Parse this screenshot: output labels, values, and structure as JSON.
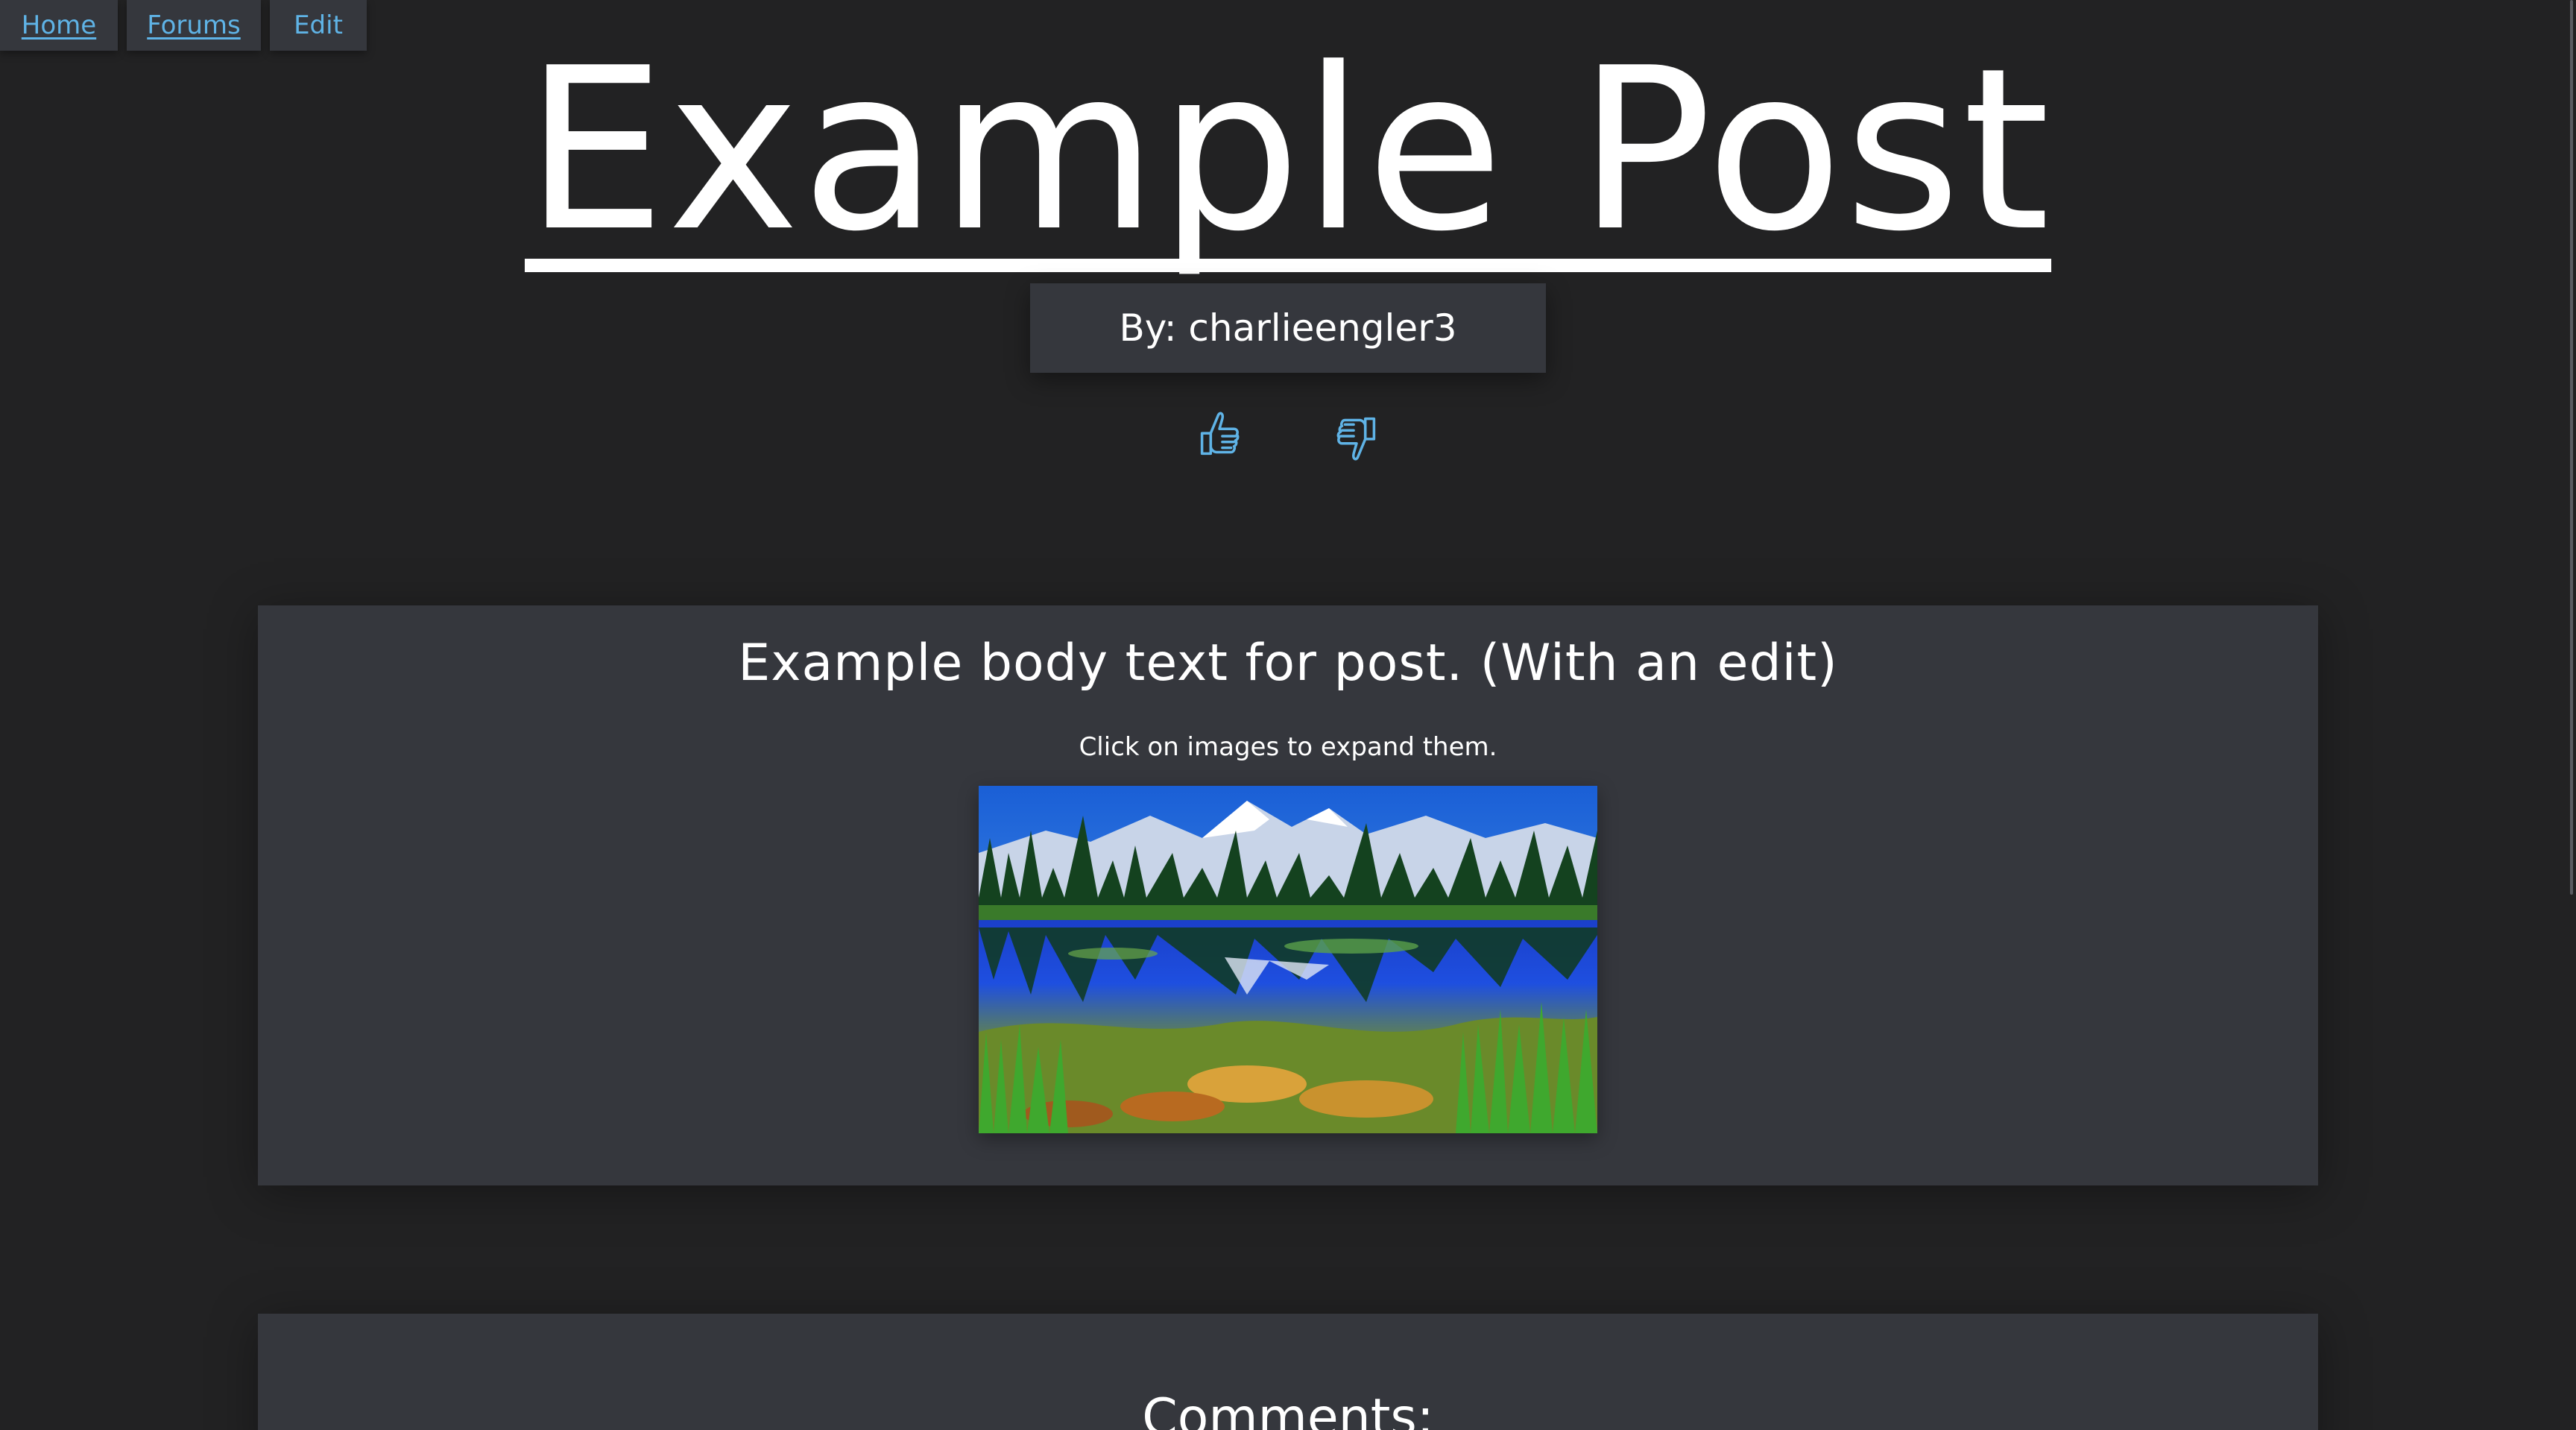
{
  "nav": {
    "items": [
      {
        "label": "Home"
      },
      {
        "label": "Forums"
      },
      {
        "label": "Edit"
      }
    ]
  },
  "post": {
    "title": "Example Post",
    "author_label": "By: charlieengler3",
    "body": "Example body text for post. (With an edit)",
    "image_hint": "Click on images to expand them."
  },
  "votes": {
    "like_icon": "thumbs-up-icon",
    "dislike_icon": "thumbs-down-icon"
  },
  "comments": {
    "title": "Comments:"
  },
  "colors": {
    "background": "#222223",
    "card": "#35373d",
    "link": "#5fb3e6",
    "text": "#ffffff"
  }
}
